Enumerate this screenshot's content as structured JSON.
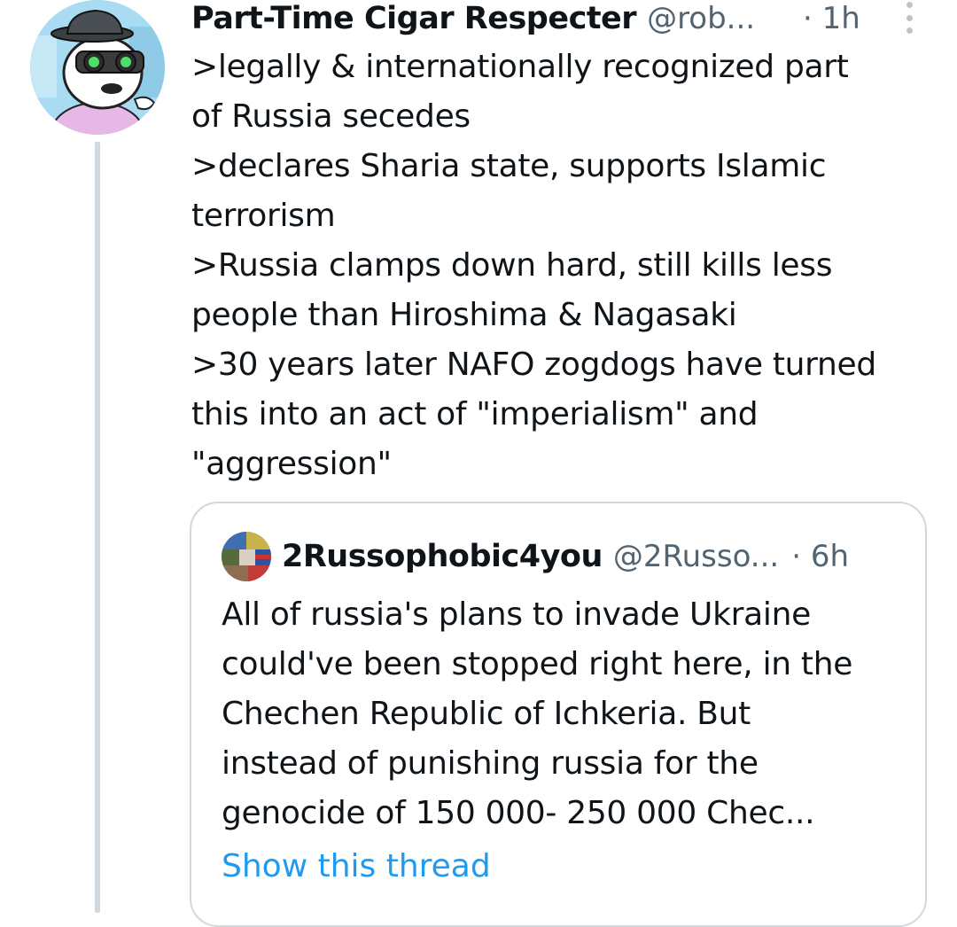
{
  "tweet": {
    "display_name": "Part-Time Cigar Respecter",
    "handle": "@rob...",
    "time": "· 1h",
    "body": ">legally & internationally recognized part\nof Russia secedes\n>declares Sharia state, supports Islamic\nterrorism\n>Russia clamps down hard, still kills less\npeople than Hiroshima & Nagasaki\n>30 years later NAFO zogdogs have turned\nthis into an act of \"imperialism\" and\n\"aggression\"",
    "avatar_icon": "cartoon-dog-with-goggles-avatar",
    "more_icon": "vertical-ellipsis-icon"
  },
  "quote": {
    "display_name": "2Russophobic4you",
    "handle": "@2Russo...",
    "time": "· 6h",
    "avatar_icon": "flag-collage-avatar",
    "body": "All of russia's plans to invade Ukraine\ncould've been stopped right here, in the\nChechen Republic of Ichkeria. But\ninstead of punishing russia for the\ngenocide of 150 000- 250 000 Chec...",
    "show_thread_label": "Show this thread"
  },
  "colors": {
    "text": "#0f1419",
    "secondary": "#536471",
    "link": "#1d9bf0",
    "border": "#cfd9de",
    "avatar_bg": "#a9dcf2"
  }
}
